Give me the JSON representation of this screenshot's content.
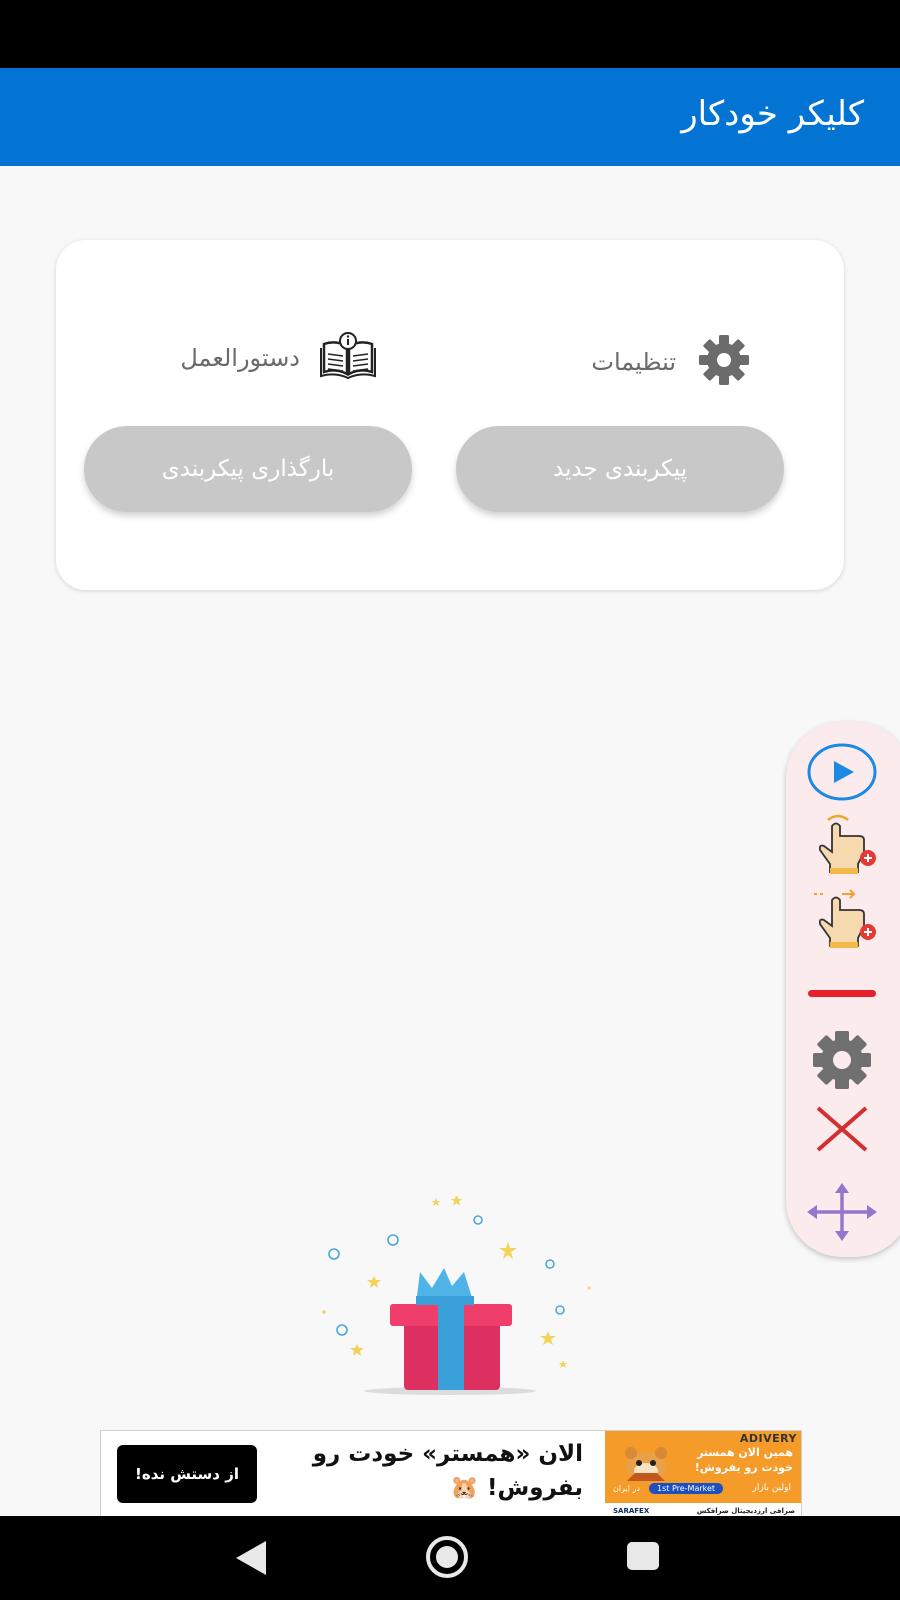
{
  "app": {
    "title": "کلیکر خودکار"
  },
  "card": {
    "settings_label": "تنظیمات",
    "manual_label": "دستورالعمل",
    "new_config_button": "پیکربندی جدید",
    "load_config_button": "بارگذاری پیکربندی"
  },
  "floating_panel": {
    "items": [
      "play-icon",
      "add-tap-icon",
      "add-swipe-icon",
      "divider",
      "gear-icon",
      "close-icon",
      "move-icon"
    ]
  },
  "ad": {
    "button": "از دستش نده!",
    "line1": "الان «همستر» خودت رو",
    "line2": "بفروش! 🐹",
    "image_brand": "ADIVERY",
    "image_headline": "همین الان همستر خودت رو بفروش!",
    "image_first_market": "اولین بازار",
    "image_badge": "1st  Pre-Market",
    "image_in_iran": "در ایران",
    "image_footer_right": "صرافی ارزدیجیتال صرافکس",
    "image_footer_left": "SARAFEX"
  },
  "colors": {
    "app_bar": "#0474d4",
    "pill_button": "#c8c8c8",
    "panel_bg": "#fcebec",
    "play": "#1e88e5",
    "divider": "#e62028",
    "close": "#d32f2f",
    "move": "#9575cd"
  }
}
